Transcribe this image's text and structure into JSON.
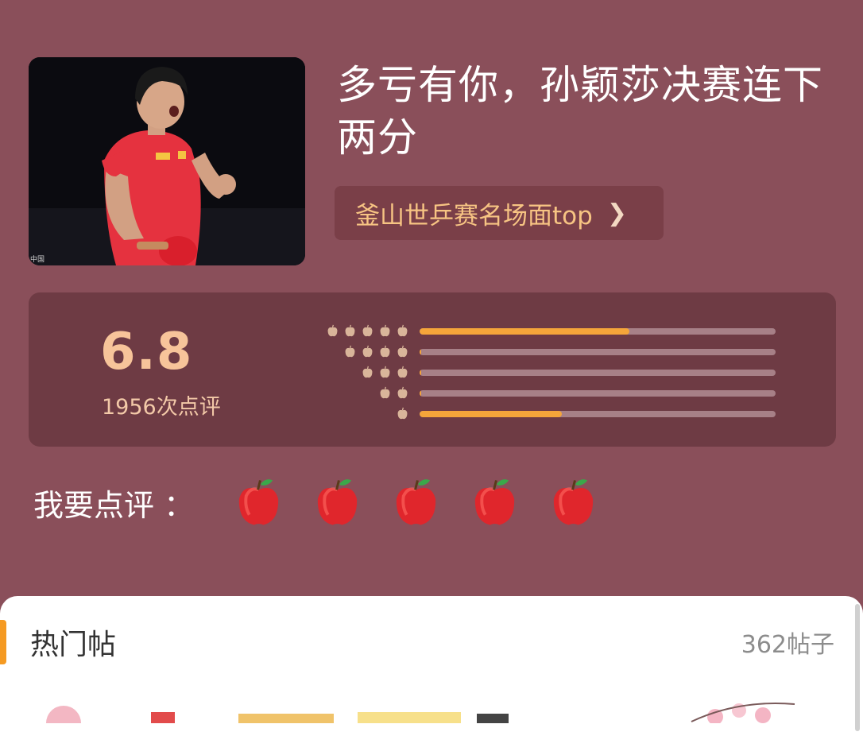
{
  "header": {
    "title": "多亏有你，孙颖莎决赛连下两分",
    "topic_chip": "釜山世乒赛名场面top",
    "photo_caption": "中国"
  },
  "rating": {
    "score": "6.8",
    "count_label": "1956次点评",
    "distribution": [
      {
        "stars": 5,
        "fraction": 0.59
      },
      {
        "stars": 4,
        "fraction": 0.005
      },
      {
        "stars": 3,
        "fraction": 0.005
      },
      {
        "stars": 2,
        "fraction": 0.005
      },
      {
        "stars": 1,
        "fraction": 0.4
      }
    ],
    "bar_color": "#f5a53a"
  },
  "my_review": {
    "label": "我要点评 ：",
    "apple_count": 5
  },
  "hot_posts": {
    "title": "热门帖",
    "count": "362帖子"
  },
  "colors": {
    "background": "#8a4f5a",
    "rating_box": "#6e3b44",
    "accent": "#f59a22"
  }
}
